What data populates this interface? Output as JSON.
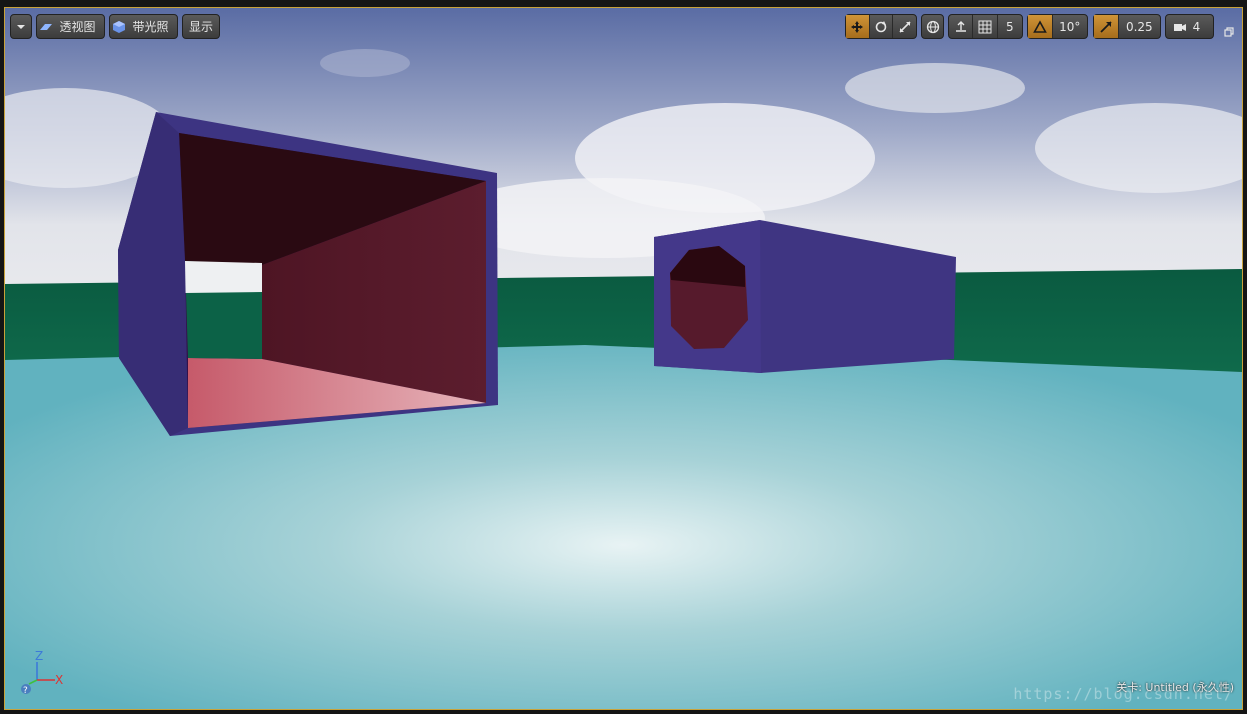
{
  "toolbar": {
    "menu_icon": "chevron-down-icon",
    "view_mode_label": "透视图",
    "lighting_label": "带光照",
    "show_label": "显示",
    "grid_snap_value": "5",
    "rotation_snap_value": "10°",
    "scale_snap_value": "0.25",
    "camera_speed_value": "4"
  },
  "footer": {
    "level_label": "关卡: Untitled (永久性)",
    "watermark": "https://blog.csdn.net/"
  },
  "gizmo": {
    "z_label": "Z",
    "x_label": "X",
    "help_label": "?"
  },
  "colors": {
    "accent": "#c8882a",
    "sky_top": "#5e6fa6",
    "floor": "#7bbfc6",
    "wall": "#0d6146",
    "box": "#3f3580"
  }
}
